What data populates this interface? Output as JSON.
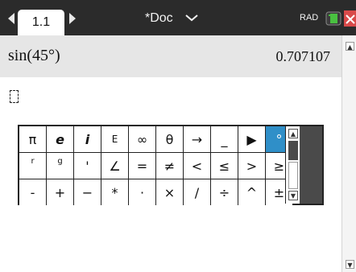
{
  "titlebar": {
    "tab_label": "1.1",
    "doc_title": "*Doc",
    "angle_mode": "RAD"
  },
  "entry": {
    "expression": "sin(45°)",
    "result": "0.707107"
  },
  "palette": {
    "rows": [
      [
        "π",
        "e",
        "i",
        "E",
        "∞",
        "θ",
        "→",
        "_",
        "▶",
        "°"
      ],
      [
        "r",
        "g",
        "'",
        "∠",
        "=",
        "≠",
        "<",
        "≤",
        ">",
        "≥"
      ],
      [
        "-",
        "+",
        "−",
        "*",
        "·",
        "×",
        "/",
        "÷",
        "^",
        "±"
      ]
    ],
    "selected": "°"
  },
  "colors": {
    "titlebar_bg": "#2b2b2b",
    "selection": "#2f8fc8",
    "close": "#d94a4a"
  },
  "icons": [
    "tab-left-arrow-icon",
    "tab-right-arrow-icon",
    "chevron-down-icon",
    "battery-icon",
    "close-icon",
    "scroll-up-icon",
    "scroll-down-icon"
  ]
}
